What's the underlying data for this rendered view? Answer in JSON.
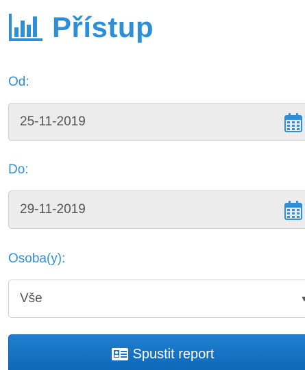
{
  "header": {
    "title": "Přístup",
    "icon": "bar-chart-icon",
    "color": "#2c8fd8"
  },
  "form": {
    "from_label": "Od:",
    "from_value": "25-11-2019",
    "to_label": "Do:",
    "to_value": "29-11-2019",
    "persons_label": "Osoba(y):",
    "persons_selected": "Vše",
    "calendar_icon": "calendar-icon",
    "calendar_icon_color": "#2c8fd8"
  },
  "actions": {
    "run_report_label": "Spustit report",
    "run_report_icon": "id-card-icon",
    "button_color": "#1a75c8"
  }
}
